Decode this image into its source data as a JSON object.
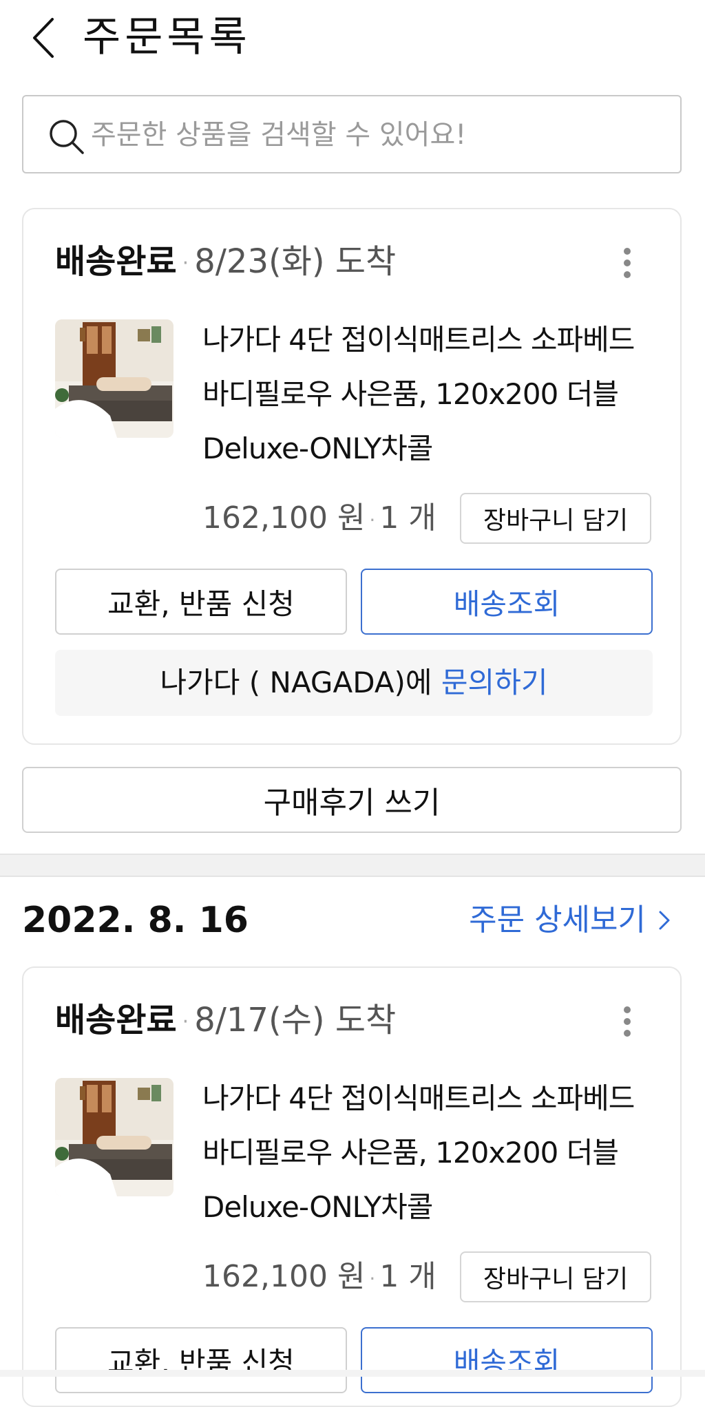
{
  "header": {
    "title": "주문목록"
  },
  "search": {
    "placeholder": "주문한 상품을 검색할 수 있어요!"
  },
  "orders": [
    {
      "status": "배송완료",
      "arrival": "8/23(화) 도착",
      "product_name": "나가다 4단 접이식매트리스 소파베드 바디필로우 사은품, 120x200 더블 Deluxe-ONLY차콜",
      "price": "162,100 원",
      "quantity": "1 개",
      "cart_label": "장바구니 담기",
      "exchange_label": "교환, 반품 신청",
      "track_label": "배송조회",
      "seller_text": "나가다 ( NAGADA)에 ",
      "inquiry_link": "문의하기",
      "review_label": "구매후기 쓰기"
    },
    {
      "date": "2022. 8. 16",
      "detail_link": "주문 상세보기",
      "status": "배송완료",
      "arrival": "8/17(수) 도착",
      "product_name": "나가다 4단 접이식매트리스 소파베드 바디필로우 사은품, 120x200 더블 Deluxe-ONLY차콜",
      "price": "162,100 원",
      "quantity": "1 개",
      "cart_label": "장바구니 담기",
      "exchange_label": "교환, 반품 신청",
      "track_label": "배송조회"
    }
  ],
  "colors": {
    "accent": "#2f6ad6",
    "border": "#d0d0d0",
    "muted": "#555555"
  }
}
